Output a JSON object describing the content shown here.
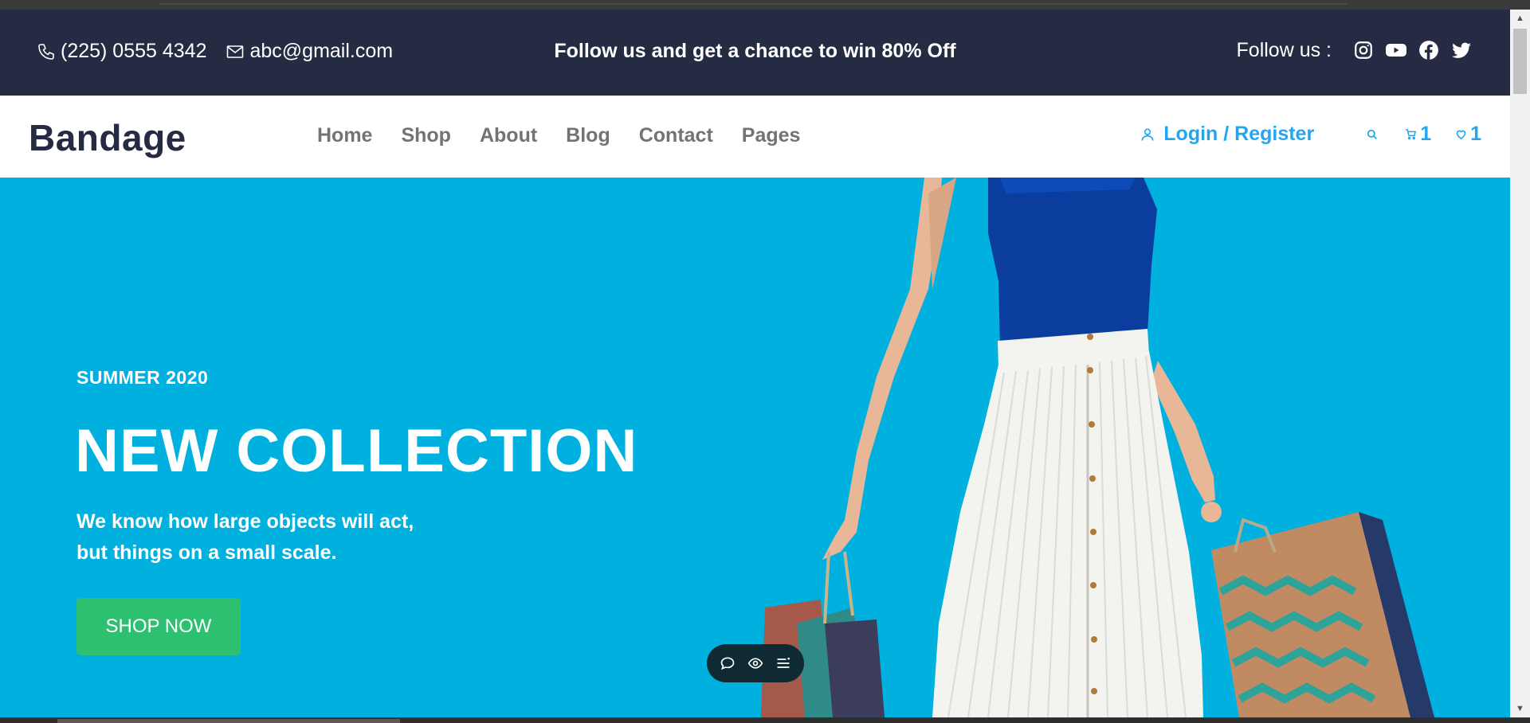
{
  "topbar": {
    "phone": "(225) 0555 4342",
    "email": "abc@gmail.com",
    "promo": "Follow us and get a chance to win 80% Off",
    "follow_label": "Follow us :",
    "socials": [
      "instagram-icon",
      "youtube-icon",
      "facebook-icon",
      "twitter-icon"
    ]
  },
  "navbar": {
    "brand": "Bandage",
    "links": [
      "Home",
      "Shop",
      "About",
      "Blog",
      "Contact",
      "Pages"
    ],
    "login": "Login / Register",
    "cart_count": "1",
    "wishlist_count": "1"
  },
  "hero": {
    "season": "SUMMER 2020",
    "headline": "NEW COLLECTION",
    "desc_line1": "We know how large objects will act,",
    "desc_line2": "but things on a small scale.",
    "cta": "SHOP NOW"
  },
  "colors": {
    "topbar_bg": "#252b42",
    "hero_bg": "#00b1df",
    "accent": "#23a6f0",
    "cta": "#2dc071",
    "nav_text": "#737373"
  }
}
